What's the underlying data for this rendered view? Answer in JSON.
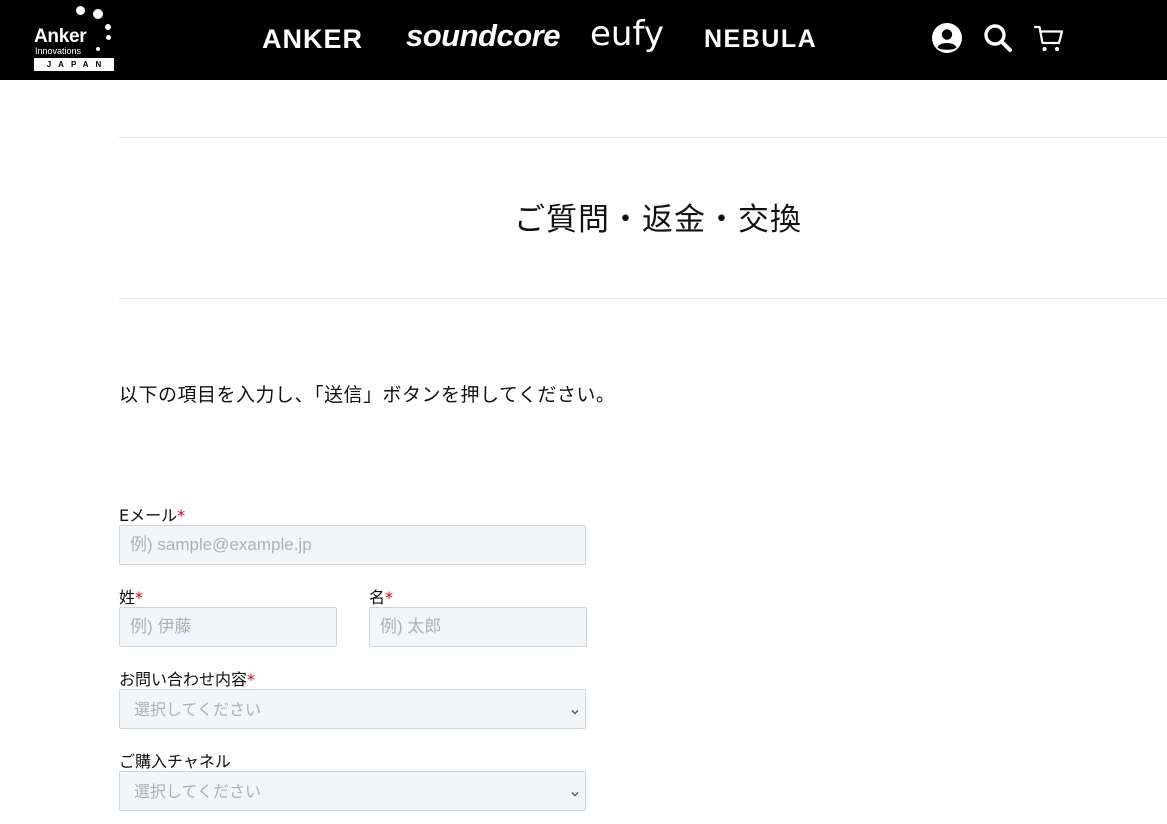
{
  "header": {
    "logo": {
      "word": "Anker",
      "sub": "Innovations",
      "country": "JAPAN"
    },
    "brands": [
      "ANKER",
      "soundcore",
      "eufy",
      "NEBULA"
    ],
    "icons": [
      "account-icon",
      "search-icon",
      "cart-icon"
    ]
  },
  "page": {
    "title": "ご質問・返金・交換",
    "intro": "以下の項目を入力し、「送信」ボタンを押してください。"
  },
  "form": {
    "email": {
      "label": "Eメール",
      "required_mark": "*",
      "placeholder": "例) sample@example.jp"
    },
    "last_name": {
      "label": "姓",
      "required_mark": "*",
      "placeholder": "例) 伊藤"
    },
    "first_name": {
      "label": "名",
      "required_mark": "*",
      "placeholder": "例) 太郎"
    },
    "inquiry_type": {
      "label": "お問い合わせ内容",
      "required_mark": "*",
      "selected": "選択してください"
    },
    "purchase_channel": {
      "label": "ご購入チャネル",
      "selected": "選択してください"
    }
  },
  "colors": {
    "header_bg": "#000000",
    "required": "#d0021b",
    "input_bg": "#f3f6f9",
    "placeholder": "#a9b2ba"
  }
}
